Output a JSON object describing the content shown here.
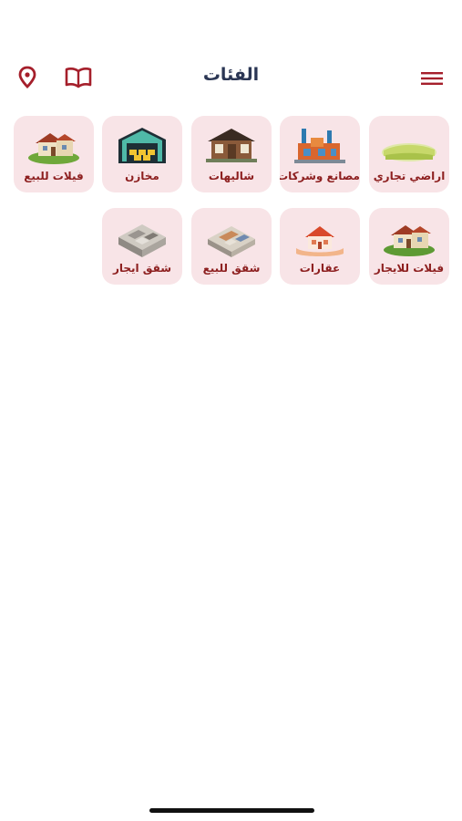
{
  "header": {
    "title": "الفئات",
    "icons": [
      "location-pin-icon",
      "book-icon",
      "hamburger-menu-icon"
    ],
    "accent_color": "#a51f2b"
  },
  "categories": [
    {
      "label": "اراضي تجاري",
      "icon": "land-field-icon"
    },
    {
      "label": "مصانع وشركات",
      "icon": "factory-icon"
    },
    {
      "label": "شاليهات",
      "icon": "chalet-icon"
    },
    {
      "label": "مخازن",
      "icon": "warehouse-icon"
    },
    {
      "label": "فيلات للبيع",
      "icon": "villa-icon"
    },
    {
      "label": "فيلات للايجار",
      "icon": "villa-rent-icon"
    },
    {
      "label": "عقارات",
      "icon": "house-hand-icon"
    },
    {
      "label": "شقق للبيع",
      "icon": "apartment-3d-icon"
    },
    {
      "label": "شقق ايجار",
      "icon": "apartment-rent-3d-icon"
    }
  ]
}
